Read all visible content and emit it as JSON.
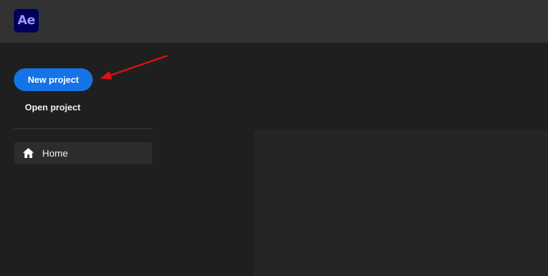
{
  "app": {
    "logo_text": "Ae",
    "logo_colors": {
      "background": "#00005b",
      "text": "#9999ff"
    }
  },
  "sidebar": {
    "new_project_label": "New project",
    "open_project_label": "Open project",
    "nav": [
      {
        "label": "Home",
        "icon": "home-icon",
        "selected": true
      }
    ]
  },
  "colors": {
    "accent": "#1473e6",
    "annotation_arrow": "#e01010",
    "topbar": "#323232",
    "background": "#1f1f1f"
  }
}
